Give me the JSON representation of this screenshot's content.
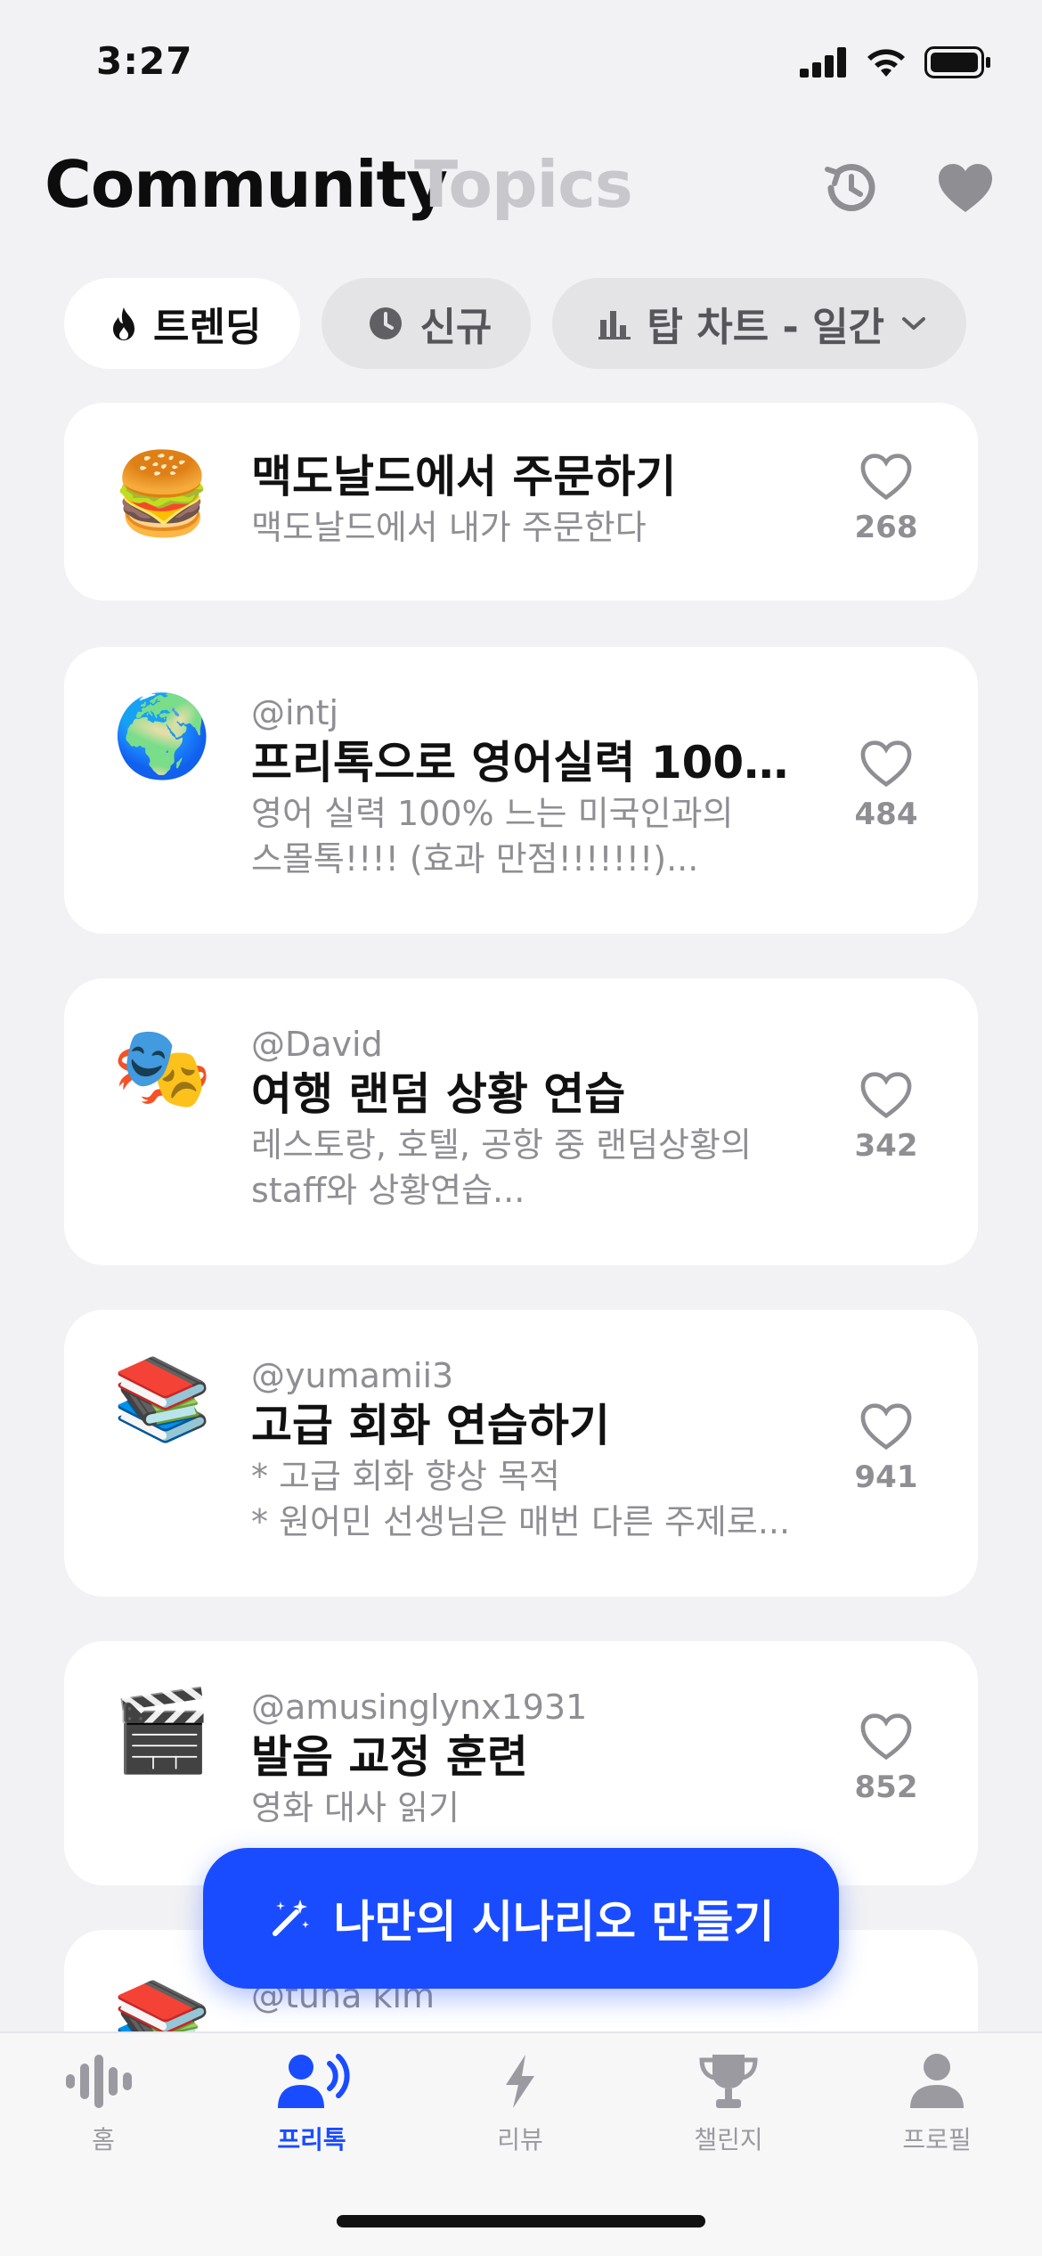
{
  "status_bar": {
    "time": "3:27"
  },
  "header": {
    "title": "Community",
    "secondary_tab": "Topics"
  },
  "filters": [
    {
      "label": "트렌딩",
      "icon": "flame-icon",
      "active": true
    },
    {
      "label": "신규",
      "icon": "clock-icon",
      "active": false
    },
    {
      "label": "탑 차트 - 일간",
      "icon": "bar-chart-icon",
      "active": false
    }
  ],
  "cards": [
    {
      "emoji": "🍔",
      "author": "",
      "title": "맥도날드에서 주문하기",
      "desc": "맥도날드에서 내가 주문한다",
      "likes": "268"
    },
    {
      "emoji": "🌍",
      "author": "@intj",
      "title": "프리톡으로 영어실력 1000...",
      "desc": "영어 실력 100% 느는 미국인과의\n스몰톡!!!! (효과 만점!!!!!!!)...",
      "likes": "484"
    },
    {
      "emoji": "🎭",
      "author": "@David",
      "title": "여행 랜덤 상황 연습",
      "desc": "레스토랑, 호텔, 공항 중 랜덤상황의\nstaff와 상황연습...",
      "likes": "342"
    },
    {
      "emoji": "📚",
      "author": "@yumamii3",
      "title": "고급 회화 연습하기",
      "desc": "* 고급 회화 향상 목적\n* 원어민 선생님은 매번 다른 주제로...",
      "likes": "941"
    },
    {
      "emoji": "🎬",
      "author": "@amusinglynx1931",
      "title": "발음 교정 훈련",
      "desc": "영화 대사 읽기",
      "likes": "852"
    },
    {
      "emoji": "📚",
      "author": "@tuna kim",
      "title": "",
      "desc": "",
      "likes": ""
    }
  ],
  "fab": {
    "label": "나만의 시나리오 만들기"
  },
  "tabbar": [
    {
      "label": "홈",
      "icon": "waveform-icon",
      "active": false
    },
    {
      "label": "프리톡",
      "icon": "person-speaking-icon",
      "active": true
    },
    {
      "label": "리뷰",
      "icon": "bolt-icon",
      "active": false
    },
    {
      "label": "챌린지",
      "icon": "trophy-icon",
      "active": false
    },
    {
      "label": "프로필",
      "icon": "person-icon",
      "active": false
    }
  ],
  "colors": {
    "accent": "#1a4cff",
    "background": "#f2f2f4",
    "muted": "#8e8e93"
  }
}
